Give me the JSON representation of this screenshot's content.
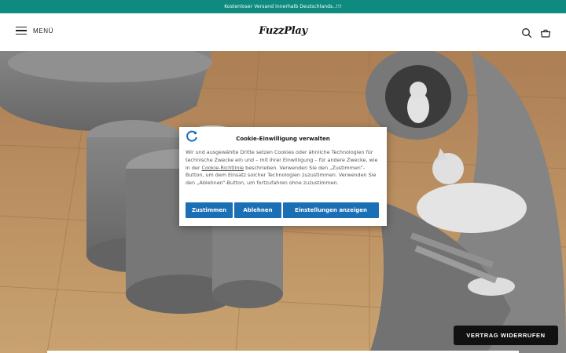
{
  "announcement": {
    "text": "Kostenloser Versand innerhalb Deutschlands..!!!"
  },
  "header": {
    "menu_label": "MENÜ",
    "logo_text": "FuzzPlay",
    "icons": [
      "menu-icon",
      "search-icon",
      "cart-icon"
    ]
  },
  "hero": {
    "scene": "cats-in-felt-tunnels"
  },
  "cookie_dialog": {
    "title": "Cookie-Einwilligung verwalten",
    "body_before_link": "Wir und ausgewählte Dritte setzen Cookies oder ähnliche Technologien für technische Zwecke ein und – mit Ihrer Einwilligung – für andere Zwecke, wie in der ",
    "link_text": "Cookie-Richtlinie",
    "body_after_link": " beschrieben. Verwenden Sie den „Zustimmen“-Button, um dem Einsatz solcher Technologien zuzustimmen. Verwenden Sie den „Ablehnen“-Button, um fortzufahren ohne zuzustimmen.",
    "buttons": {
      "accept": "Zustimmen",
      "reject": "Ablehnen",
      "settings": "Einstellungen anzeigen"
    },
    "accent_color": "#1a6fb5"
  },
  "withdraw_button": {
    "label": "VERTRAG WIDERRUFEN"
  },
  "colors": {
    "announcement_bg": "#0e8a7e",
    "button_dark": "#111111"
  }
}
